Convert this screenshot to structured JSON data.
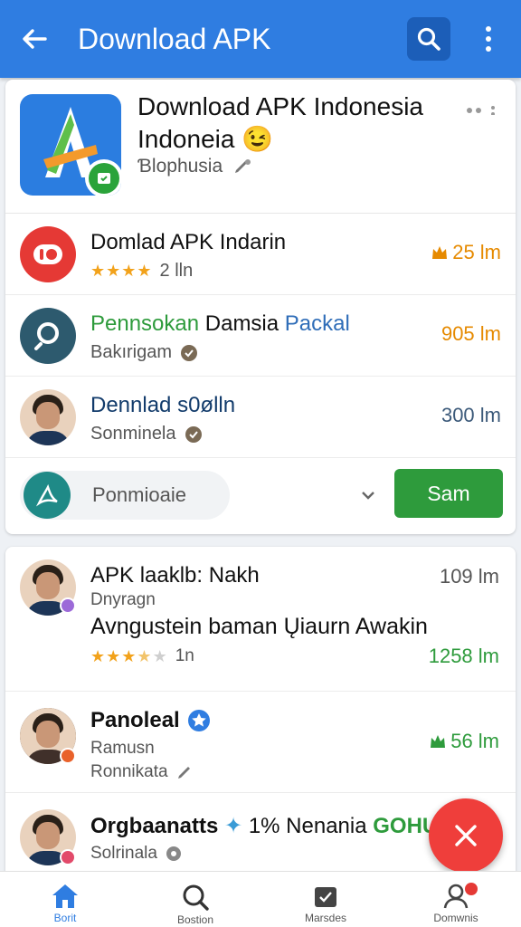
{
  "appbar": {
    "title": "Download APK"
  },
  "featured": {
    "title": "Download APK Indonesia Indoneia 😉",
    "subtitle": "Ɓlophusia"
  },
  "list1": [
    {
      "title": "Domlad APK Indarin",
      "rating_text": "2 lln",
      "stars": 4,
      "meta": "25 lm",
      "meta_color": "#e68a00"
    },
    {
      "title_parts": [
        "Pennsokan",
        " Damsia",
        " Packal"
      ],
      "subtitle": "Bakırigam",
      "meta": "905 lm",
      "meta_color": "#e68a00"
    },
    {
      "title": "Dennlad s0ølln",
      "subtitle": "Sonminela",
      "meta": "300 lm",
      "meta_color": "#3c5a7a"
    }
  ],
  "action": {
    "pill_label": "Ponmioaie",
    "cta_label": "Sam"
  },
  "list2": [
    {
      "title": "APK laaklb: Nakh",
      "subtitle": "Dnyragn",
      "line3": "Avngustein baman Ųiaurn Awakin",
      "rating_text": "1n",
      "stars": 3.5,
      "meta": "109 lm",
      "meta2": "1258 lm"
    },
    {
      "title": "Panoleal",
      "subtitle": "Ramusn",
      "line3": "Ronnikata",
      "meta": "56 lm"
    },
    {
      "title": "Orgbaanatts",
      "title_extra": "1% Nenania",
      "title_green": "GOHUIP",
      "subtitle": "Solrinala"
    }
  ],
  "bottom_nav": [
    {
      "label": "Borit",
      "icon": "home-icon"
    },
    {
      "label": "Bostion",
      "icon": "search-icon"
    },
    {
      "label": "Marsdes",
      "icon": "box-icon"
    },
    {
      "label": "Domwnis",
      "icon": "person-icon"
    }
  ],
  "colors": {
    "primary": "#2f7de1",
    "green": "#2e9b3c",
    "fab": "#ef3e3b",
    "star": "#f2a21b"
  }
}
